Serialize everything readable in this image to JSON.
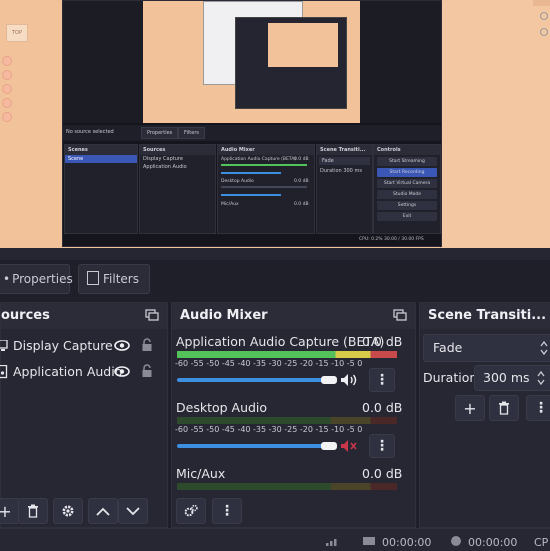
{
  "tabs": {
    "properties": "Properties",
    "filters": "Filters"
  },
  "sources": {
    "title": "ources",
    "items": [
      {
        "label": "Display Capture"
      },
      {
        "label": "Application Audio"
      }
    ]
  },
  "mixer": {
    "title": "Audio Mixer",
    "ticks": "-60 -55 -50 -45 -40 -35 -30 -25 -20 -15 -10 -5 0",
    "channels": [
      {
        "name": "Application Audio Capture (BETA)",
        "db": "0.0 dB",
        "volume": 0.9,
        "muted": false
      },
      {
        "name": "Desktop Audio",
        "db": "0.0 dB",
        "volume": 0.9,
        "muted": true
      },
      {
        "name": "Mic/Aux",
        "db": "0.0 dB",
        "volume": 0.9,
        "muted": false
      }
    ]
  },
  "transitions": {
    "title": "Scene Transiti...",
    "selected": "Fade",
    "duration_label": "Duration",
    "duration_value": "300 ms"
  },
  "status": {
    "rec_time": "00:00:00",
    "stream_time": "00:00:00",
    "cpu": "CP"
  },
  "preview": {
    "no_source": "No source selected",
    "tab_properties": "Properties",
    "tab_filters": "Filters",
    "scenes_title": "Scenes",
    "scene_item": "Scene",
    "sources_title": "Sources",
    "source_1": "Display Capture",
    "source_2": "Application Audio",
    "mixer_title": "Audio Mixer",
    "mixer_ch1": "Application Audio Capture (BETA)",
    "mixer_ch2": "Desktop Audio",
    "mixer_ch3": "Mic/Aux",
    "mixer_db": "0.0 dB",
    "trans_title": "Scene Transiti...",
    "trans_sel": "Fade",
    "trans_dur_label": "Duration",
    "trans_dur": "300 ms",
    "controls_title": "Controls",
    "ctrl_stream": "Start Streaming",
    "ctrl_record": "Start Recording",
    "ctrl_vcam": "Start Virtual Camera",
    "ctrl_studio": "Studio Mode",
    "ctrl_settings": "Settings",
    "ctrl_exit": "Exit",
    "status": "CPU: 0.2%   30.00 / 30.00 FPS",
    "top_icon": "TOP"
  },
  "colors": {
    "accent": "#3d8fe0",
    "meter_green": "#53c25a",
    "mute_red": "#c8384a"
  }
}
